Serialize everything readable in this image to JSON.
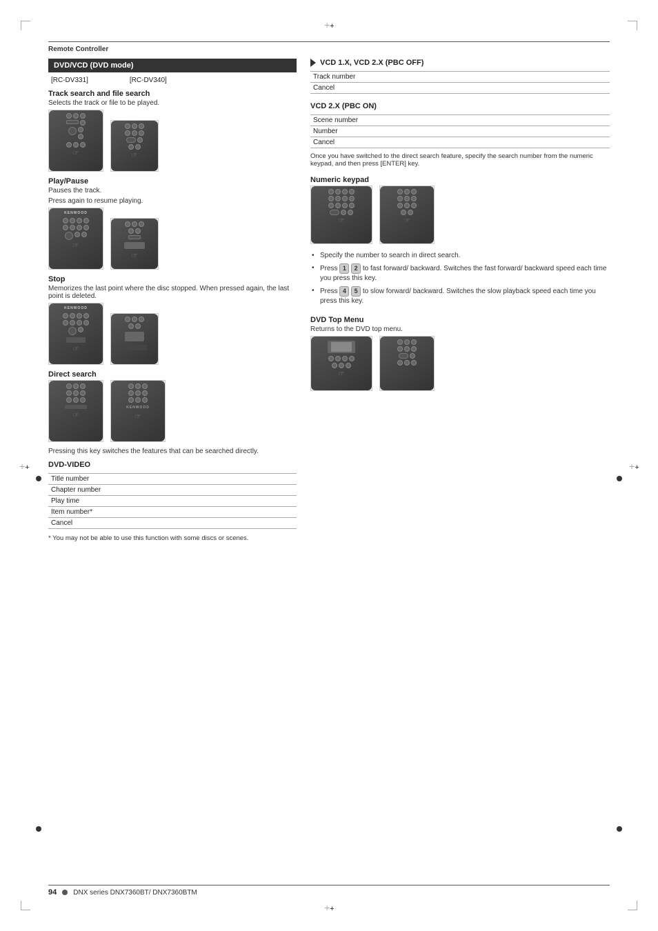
{
  "page": {
    "section_header": "Remote Controller",
    "left_col": {
      "dvd_box_label": "DVD/VCD (DVD mode)",
      "rc_label_1": "[RC-DV331]",
      "rc_label_2": "[RC-DV340]",
      "track_search": {
        "title": "Track search and file search",
        "desc": "Selects the track or file to be played."
      },
      "play_pause": {
        "title": "Play/Pause",
        "desc1": "Pauses the track.",
        "desc2": "Press again to resume playing."
      },
      "stop": {
        "title": "Stop",
        "desc": "Memorizes the last point where the disc stopped. When pressed again, the last point is deleted."
      },
      "direct_search": {
        "title": "Direct search",
        "desc": "Pressing this key switches the features that can be searched directly."
      },
      "dvd_video": {
        "title": "DVD-VIDEO",
        "items": [
          "Title number",
          "Chapter number",
          "Play time",
          "Item number*",
          "Cancel"
        ]
      },
      "footnote": "* You may not be able to use this function with some discs or scenes."
    },
    "right_col": {
      "vcd1_title": "VCD 1.X, VCD 2.X (PBC OFF)",
      "vcd1_items": [
        "Track number",
        "Cancel"
      ],
      "vcd2_title": "VCD 2.X (PBC ON)",
      "vcd2_items": [
        "Scene number",
        "Number",
        "Cancel"
      ],
      "note_text": "Once you have switched to the direct search feature, specify the search number from the numeric keypad, and then press [ENTER] key.",
      "numeric_keypad": {
        "title": "Numeric keypad"
      },
      "bullets": [
        "Specify the number to search in direct search.",
        "Press  1   2  to fast forward/ backward. Switches the fast forward/ backward speed each time you press this key.",
        "Press  4   5  to slow forward/ backward. Switches the slow playback speed each time you press this key."
      ],
      "dvd_top_menu": {
        "title": "DVD Top Menu",
        "desc": "Returns to the DVD top menu."
      }
    },
    "footer": {
      "page_number": "94",
      "model_text": "DNX series  DNX7360BT/ DNX7360BTM"
    }
  }
}
